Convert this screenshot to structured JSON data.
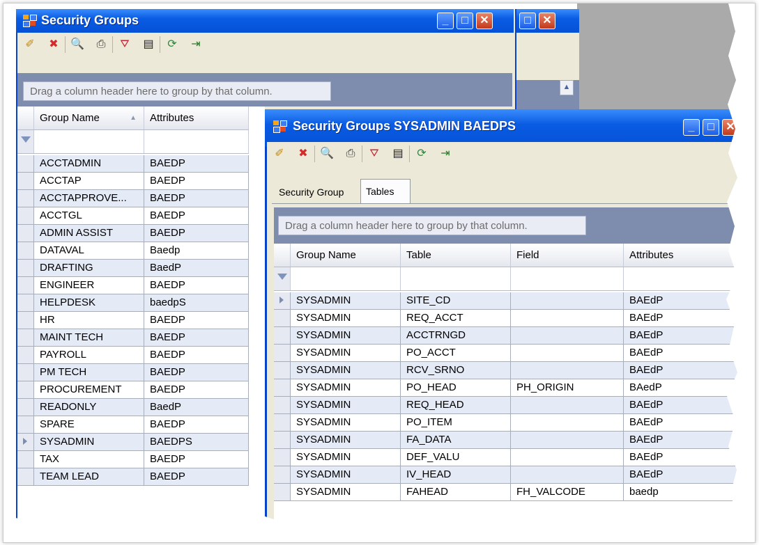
{
  "back_window": {
    "title": "Security Groups",
    "toolbar": [
      {
        "name": "edit-icon",
        "glyph": "✐"
      },
      {
        "name": "delete-icon",
        "glyph": "✖"
      },
      {
        "name": "preview-icon",
        "glyph": "🔍"
      },
      {
        "name": "print-icon",
        "glyph": "⎙"
      },
      {
        "name": "filter-icon",
        "glyph": "⛛"
      },
      {
        "name": "layout-icon",
        "glyph": "▤"
      },
      {
        "name": "refresh-icon",
        "glyph": "⟳"
      },
      {
        "name": "exit-icon",
        "glyph": "⇥"
      }
    ],
    "group_hint": "Drag a column header here to group by that column.",
    "columns": [
      "Group Name",
      "Attributes"
    ],
    "rows": [
      [
        "ACCTADMIN",
        "BAEDP"
      ],
      [
        "ACCTAP",
        "BAEDP"
      ],
      [
        "ACCTAPPROVE...",
        "BAEDP"
      ],
      [
        "ACCTGL",
        "BAEDP"
      ],
      [
        "ADMIN ASSIST",
        "BAEDP"
      ],
      [
        "DATAVAL",
        "Baedp"
      ],
      [
        "DRAFTING",
        "BaedP"
      ],
      [
        "ENGINEER",
        "BAEDP"
      ],
      [
        "HELPDESK",
        "baedpS"
      ],
      [
        "HR",
        "BAEDP"
      ],
      [
        "MAINT TECH",
        "BAEDP"
      ],
      [
        "PAYROLL",
        "BAEDP"
      ],
      [
        "PM TECH",
        "BAEDP"
      ],
      [
        "PROCUREMENT",
        "BAEDP"
      ],
      [
        "READONLY",
        "BaedP"
      ],
      [
        "SPARE",
        "BAEDP"
      ],
      [
        "SYSADMIN",
        "BAEDPS"
      ],
      [
        "TAX",
        "BAEDP"
      ],
      [
        "TEAM LEAD",
        "BAEDP"
      ]
    ],
    "current_row": 16
  },
  "front_window": {
    "title": "Security Groups  SYSADMIN BAEDPS",
    "tabs": [
      "Security Group",
      "Tables"
    ],
    "active_tab": 1,
    "group_hint": "Drag a column header here to group by that column.",
    "columns": [
      "Group Name",
      "Table",
      "Field",
      "Attributes"
    ],
    "rows": [
      [
        "SYSADMIN",
        "SITE_CD",
        "",
        "BAEdP"
      ],
      [
        "SYSADMIN",
        "REQ_ACCT",
        "",
        "BAEdP"
      ],
      [
        "SYSADMIN",
        "ACCTRNGD",
        "",
        "BAEdP"
      ],
      [
        "SYSADMIN",
        "PO_ACCT",
        "",
        "BAEdP"
      ],
      [
        "SYSADMIN",
        "RCV_SRNO",
        "",
        "BAEdP"
      ],
      [
        "SYSADMIN",
        "PO_HEAD",
        "PH_ORIGIN",
        "BAedP"
      ],
      [
        "SYSADMIN",
        "REQ_HEAD",
        "",
        "BAEdP"
      ],
      [
        "SYSADMIN",
        "PO_ITEM",
        "",
        "BAEdP"
      ],
      [
        "SYSADMIN",
        "FA_DATA",
        "",
        "BAEdP"
      ],
      [
        "SYSADMIN",
        "DEF_VALU",
        "",
        "BAEdP"
      ],
      [
        "SYSADMIN",
        "IV_HEAD",
        "",
        "BAEdP"
      ],
      [
        "SYSADMIN",
        "FAHEAD",
        "FH_VALCODE",
        "baedp"
      ]
    ],
    "current_row": 0
  },
  "colors": {
    "title_bar": "#0a5ce3",
    "row_alt": "#e4eaf6",
    "group_area": "#7e8dad"
  }
}
